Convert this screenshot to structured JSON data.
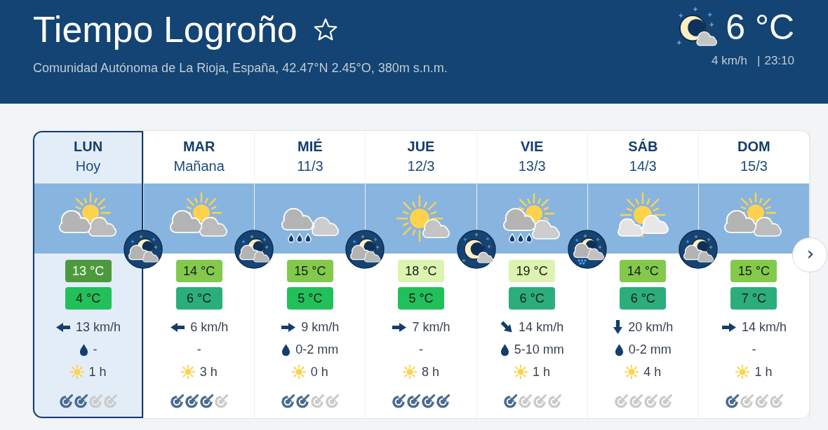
{
  "header": {
    "title": "Tiempo Logroño",
    "favorite": false,
    "subtitle": "Comunidad Autónoma de La Rioja, España, 42.47°N 2.45°O, 380m s.n.m.",
    "current": {
      "icon": {
        "kind": "moon-cloud"
      },
      "temperature": "6 °C",
      "wind": "4 km/h",
      "separator": "|",
      "time": "23:10"
    }
  },
  "forecast": {
    "days": [
      {
        "day": "LUN",
        "date": "Hoy",
        "selected": true,
        "icon": {
          "kind": "sun-clouds"
        },
        "night_icon": {
          "kind": "moon-clouds"
        },
        "max": {
          "text": "13 °C",
          "color": "#4d9a3c"
        },
        "min": {
          "text": "4 °C",
          "color": "#22c05a"
        },
        "wind": {
          "kind": "left",
          "speed": "13 km/h"
        },
        "rain": {
          "drop": true,
          "amount": "-"
        },
        "sunshine": "1 h",
        "reliability": [
          {
            "filled": true
          },
          {
            "filled": true
          },
          {
            "filled": false
          },
          {
            "filled": false
          }
        ]
      },
      {
        "day": "MAR",
        "date": "Mañana",
        "selected": false,
        "icon": {
          "kind": "sun-clouds"
        },
        "night_icon": {
          "kind": "moon-clouds"
        },
        "max": {
          "text": "14 °C",
          "color": "#82c94c"
        },
        "min": {
          "text": "6 °C",
          "color": "#2bae7c"
        },
        "wind": {
          "kind": "left",
          "speed": "6 km/h"
        },
        "rain": {
          "drop": false,
          "amount": "-"
        },
        "sunshine": "3 h",
        "reliability": [
          {
            "filled": true
          },
          {
            "filled": true
          },
          {
            "filled": true
          },
          {
            "filled": false
          }
        ]
      },
      {
        "day": "MIÉ",
        "date": "11/3",
        "selected": false,
        "icon": {
          "kind": "rain-clouds"
        },
        "night_icon": {
          "kind": "moon-clouds"
        },
        "max": {
          "text": "15 °C",
          "color": "#82c94c"
        },
        "min": {
          "text": "5 °C",
          "color": "#22c05a"
        },
        "wind": {
          "kind": "right",
          "speed": "9 km/h"
        },
        "rain": {
          "drop": true,
          "amount": "0-2 mm"
        },
        "sunshine": "0 h",
        "reliability": [
          {
            "filled": true
          },
          {
            "filled": true
          },
          {
            "filled": false
          },
          {
            "filled": false
          }
        ]
      },
      {
        "day": "JUE",
        "date": "12/3",
        "selected": false,
        "icon": {
          "kind": "sun-cloud"
        },
        "night_icon": {
          "kind": "moon-cloud"
        },
        "max": {
          "text": "18 °C",
          "color": "#dcf4b0"
        },
        "min": {
          "text": "5 °C",
          "color": "#22c05a"
        },
        "wind": {
          "kind": "right",
          "speed": "7 km/h"
        },
        "rain": {
          "drop": false,
          "amount": "-"
        },
        "sunshine": "8 h",
        "reliability": [
          {
            "filled": true
          },
          {
            "filled": true
          },
          {
            "filled": true
          },
          {
            "filled": true
          }
        ]
      },
      {
        "day": "VIE",
        "date": "13/3",
        "selected": false,
        "icon": {
          "kind": "sun-rain-clouds"
        },
        "night_icon": {
          "kind": "moon-snow"
        },
        "max": {
          "text": "19 °C",
          "color": "#dcf4b0"
        },
        "min": {
          "text": "6 °C",
          "color": "#2bae7c"
        },
        "wind": {
          "kind": "down-right",
          "speed": "14 km/h"
        },
        "rain": {
          "drop": true,
          "amount": "5-10 mm"
        },
        "sunshine": "1 h",
        "reliability": [
          {
            "filled": true
          },
          {
            "filled": false
          },
          {
            "filled": false
          },
          {
            "filled": false
          }
        ]
      },
      {
        "day": "SÁB",
        "date": "14/3",
        "selected": false,
        "icon": {
          "kind": "sun-light-clouds"
        },
        "night_icon": {
          "kind": "moon-clouds"
        },
        "max": {
          "text": "14 °C",
          "color": "#82c94c"
        },
        "min": {
          "text": "6 °C",
          "color": "#2bae7c"
        },
        "wind": {
          "kind": "down",
          "speed": "20 km/h"
        },
        "rain": {
          "drop": true,
          "amount": "0-2 mm"
        },
        "sunshine": "4 h",
        "reliability": [
          {
            "filled": false
          },
          {
            "filled": false
          },
          {
            "filled": false
          },
          {
            "filled": false
          }
        ]
      },
      {
        "day": "DOM",
        "date": "15/3",
        "selected": false,
        "icon": {
          "kind": "sun-clouds"
        },
        "max": {
          "text": "15 °C",
          "color": "#82c94c"
        },
        "min": {
          "text": "7 °C",
          "color": "#2bae7c"
        },
        "wind": {
          "kind": "right",
          "speed": "14 km/h"
        },
        "rain": {
          "drop": false,
          "amount": "-"
        },
        "sunshine": "1 h",
        "reliability": [
          {
            "filled": true
          },
          {
            "filled": false
          },
          {
            "filled": false
          },
          {
            "filled": false
          }
        ]
      }
    ],
    "next_button": "›"
  }
}
